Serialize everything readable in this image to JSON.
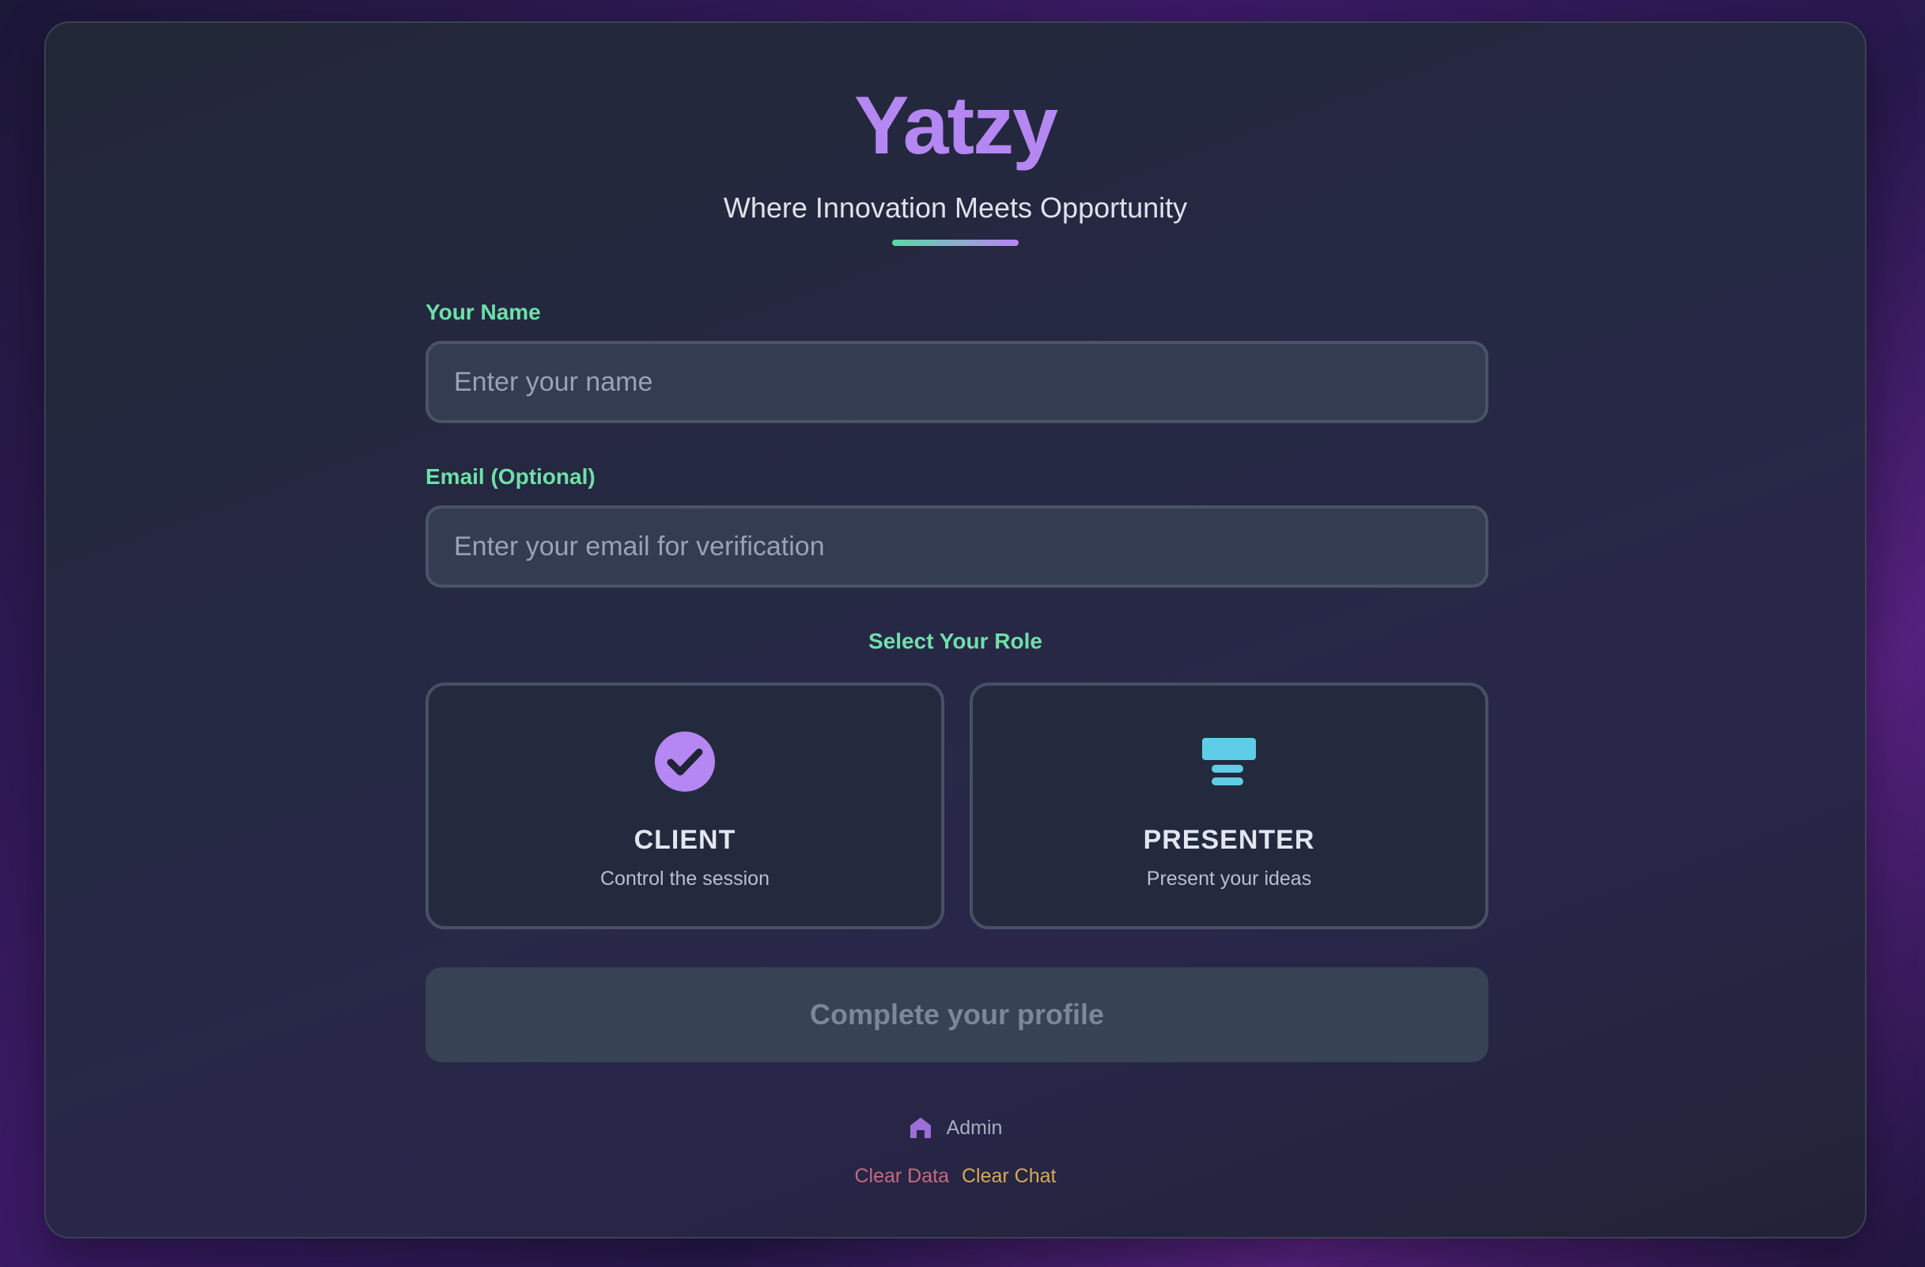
{
  "app": {
    "brand": "Yatzy",
    "tagline": "Where Innovation Meets Opportunity"
  },
  "form": {
    "name": {
      "label": "Your Name",
      "value": "",
      "placeholder": "Enter your name"
    },
    "email": {
      "label": "Email (Optional)",
      "value": "",
      "placeholder": "Enter your email for verification"
    },
    "role_heading": "Select Your Role",
    "roles": [
      {
        "title": "CLIENT",
        "subtitle": "Control the session",
        "icon": "check-circle-icon"
      },
      {
        "title": "PRESENTER",
        "subtitle": "Present your ideas",
        "icon": "presentation-icon"
      }
    ],
    "submit_label": "Complete your profile"
  },
  "footer": {
    "admin_label": "Admin",
    "admin_icon": "home-icon",
    "clear_data_label": "Clear Data",
    "clear_chat_label": "Clear Chat"
  },
  "colors": {
    "accent_green": "#6fe0a9",
    "accent_purple": "#b587f2",
    "accent_cyan": "#5fcde8",
    "danger": "#c46a7e",
    "warning": "#d6a956"
  }
}
